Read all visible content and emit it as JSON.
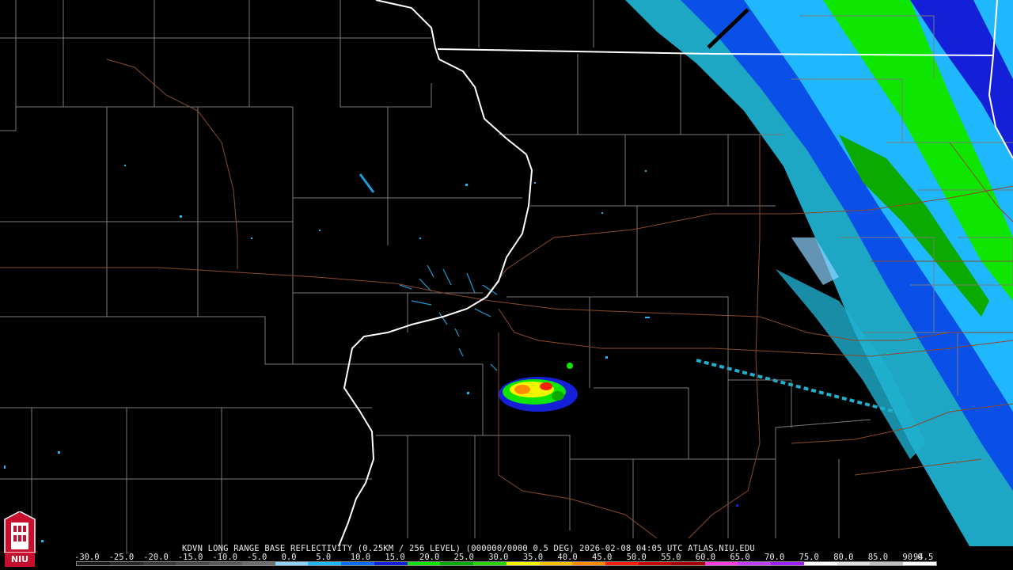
{
  "map": {
    "title_caption": "KDVN LONG RANGE BASE REFLECTIVITY (0.25KM / 256 LEVEL) (000000/0000 0.5 DEG) 2026-02-08 04:05 UTC  ATLAS.NIU.EDU",
    "scale_values": [
      "-30.0",
      "-25.0",
      "-20.0",
      "-15.0",
      "-10.0",
      "-5.0",
      "0.0",
      "5.0",
      "10.0",
      "15.0",
      "20.0",
      "25.0",
      "30.0",
      "35.0",
      "40.0",
      "45.0",
      "50.0",
      "55.0",
      "60.0",
      "65.0",
      "70.0",
      "75.0",
      "80.0",
      "85.0",
      "90.0",
      "94.5"
    ],
    "scale_colors": [
      "#1a1a1a",
      "#2a2a2a",
      "#3a3a3a",
      "#4a4a4a",
      "#5a5a5a",
      "#6e6e6e",
      "#8fd3ff",
      "#1fb8ff",
      "#0a6fff",
      "#1320d8",
      "#0ee600",
      "#0aaa00",
      "#2bd400",
      "#f5f500",
      "#f5c000",
      "#ff8c00",
      "#ff1e00",
      "#c80000",
      "#a00000",
      "#ff3ce0",
      "#c63cff",
      "#9e1eff",
      "#ffffff",
      "#e0e0e0",
      "#c0c0c0",
      "#ffffff"
    ],
    "colors": {
      "background": "#000000",
      "county_line": "#7a7a7a",
      "state_line": "#ffffff",
      "highway": "#8a4a2a"
    },
    "logo_text": "NIU",
    "logo_icon": "niu-tower-logo-icon"
  }
}
